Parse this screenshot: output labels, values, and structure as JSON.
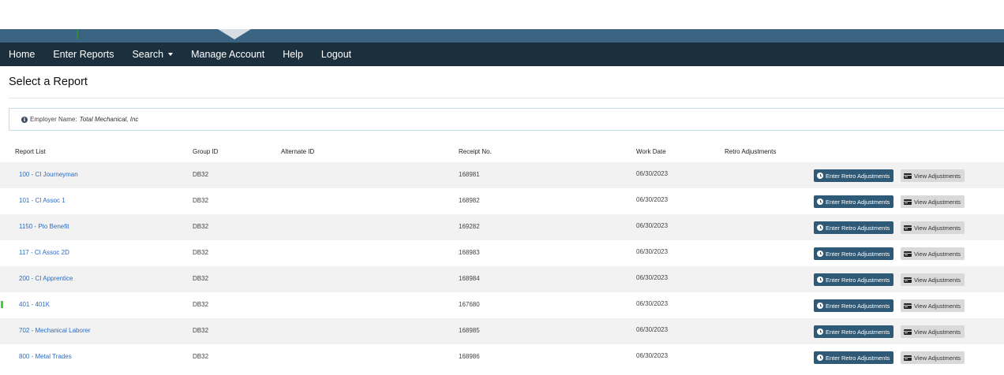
{
  "nav": {
    "items": [
      "Home",
      "Enter Reports",
      "Search",
      "Manage Account",
      "Help",
      "Logout"
    ]
  },
  "page": {
    "title": "Select a Report"
  },
  "info": {
    "label": "Employer Name:",
    "value": "Total Mechanical, Inc"
  },
  "table": {
    "headers": {
      "report_list": "Report List",
      "group_id": "Group ID",
      "alternate_id": "Alternate ID",
      "receipt_no": "Receipt No.",
      "work_date": "Work Date",
      "retro_adjustments": "Retro Adjustments"
    },
    "enter_retro_label": "Enter Retro Adjustments",
    "view_adjustments_label": "View Adjustments",
    "rows": [
      {
        "report": "100 - CI Journeyman",
        "group_id": "DB32",
        "alternate_id": "",
        "receipt_no": "168981",
        "work_date": "06/30/2023"
      },
      {
        "report": "101 - CI Assoc 1",
        "group_id": "DB32",
        "alternate_id": "",
        "receipt_no": "168982",
        "work_date": "06/30/2023"
      },
      {
        "report": "1150 - Pto Benefit",
        "group_id": "DB32",
        "alternate_id": "",
        "receipt_no": "169282",
        "work_date": "06/30/2023"
      },
      {
        "report": "117 - CI Assoc 2D",
        "group_id": "DB32",
        "alternate_id": "",
        "receipt_no": "168983",
        "work_date": "06/30/2023"
      },
      {
        "report": "200 - CI Apprentice",
        "group_id": "DB32",
        "alternate_id": "",
        "receipt_no": "168984",
        "work_date": "06/30/2023"
      },
      {
        "report": "401 - 401K",
        "group_id": "DB32",
        "alternate_id": "",
        "receipt_no": "167680",
        "work_date": "06/30/2023"
      },
      {
        "report": "702 - Mechanical Laborer",
        "group_id": "DB32",
        "alternate_id": "",
        "receipt_no": "168985",
        "work_date": "06/30/2023"
      },
      {
        "report": "800 - Metal Trades",
        "group_id": "DB32",
        "alternate_id": "",
        "receipt_no": "168986",
        "work_date": "06/30/2023"
      }
    ]
  },
  "colors": {
    "navbar": "#1c2f3d",
    "banner": "#3a6482",
    "link": "#2b6cc4",
    "primary_button": "#2e5a78",
    "secondary_button": "#d9d9d9"
  },
  "icons": {
    "info": "info-circle-icon",
    "clock": "clock-icon",
    "card": "credit-card-icon",
    "caret": "caret-down-icon"
  }
}
